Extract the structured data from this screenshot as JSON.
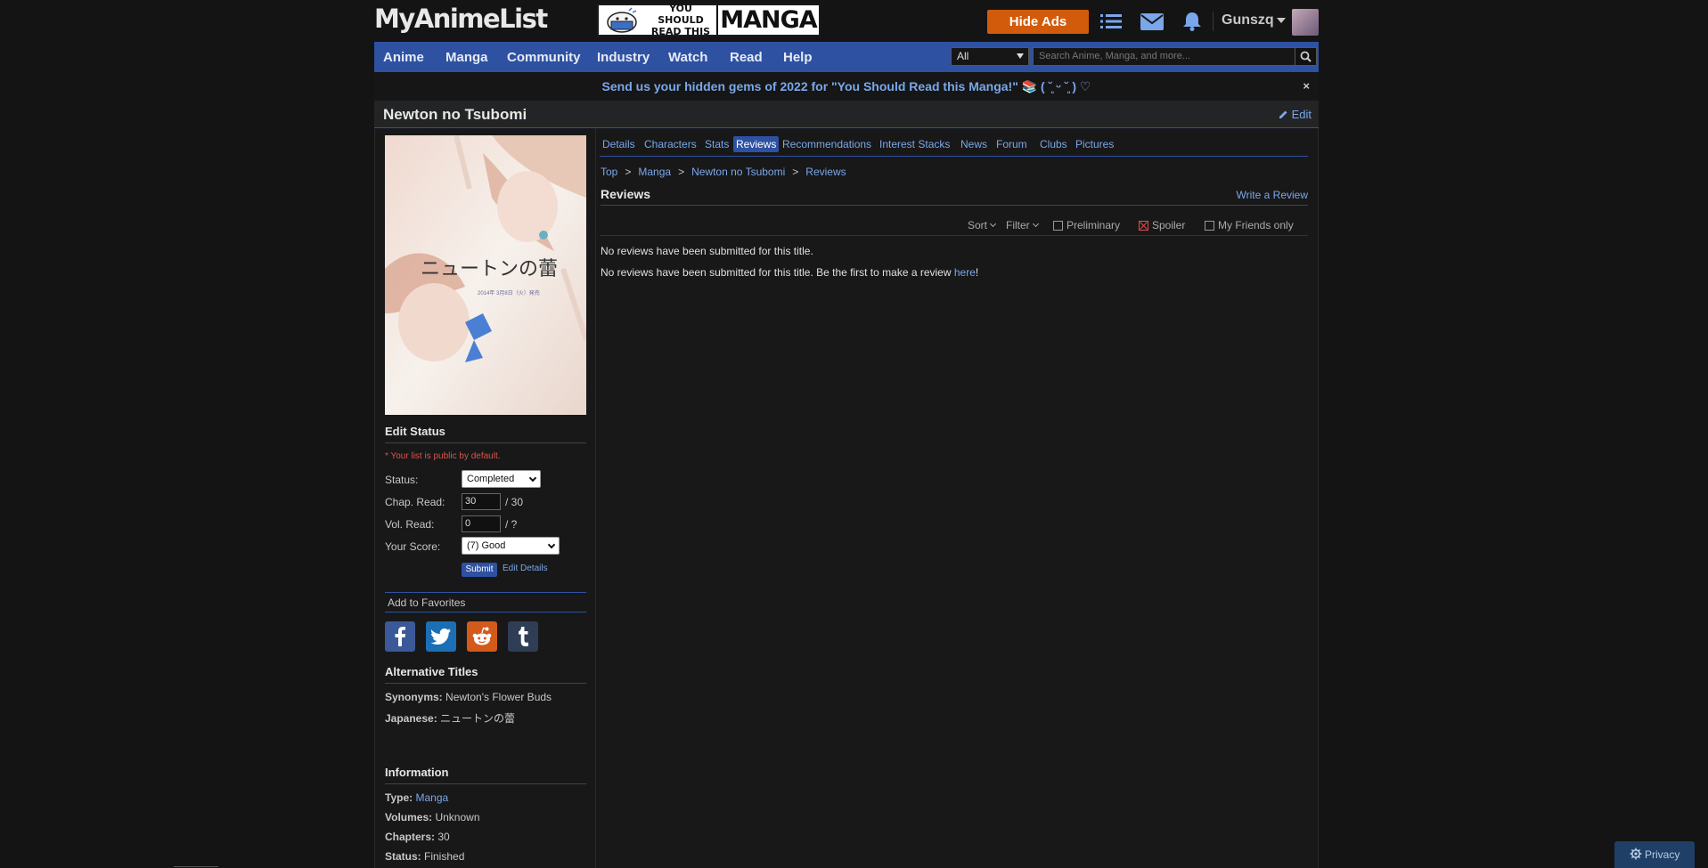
{
  "header": {
    "logo": "MyAnimeList",
    "banner_small": "YOU SHOULD READ THIS",
    "banner_big": "MANGA",
    "hide_ads": "Hide Ads",
    "username": "Gunszq"
  },
  "nav": {
    "items": [
      "Anime",
      "Manga",
      "Community",
      "Industry",
      "Watch",
      "Read",
      "Help"
    ],
    "search_scope": "All",
    "search_placeholder": "Search Anime, Manga, and more..."
  },
  "announcement": {
    "text": "Send us your hidden gems of 2022 for \"You Should Read this Manga!\" 📚 ( ˘͈ ᵕ ˘͈ ) ♡",
    "close": "×"
  },
  "title": {
    "text": "Newton no Tsubomi",
    "edit": "Edit"
  },
  "cover": {
    "text_main": "ニュートンの蕾",
    "text_sub": "2014年 3月8日（火）発売"
  },
  "edit_status": {
    "heading": "Edit Status",
    "note": "* Your list is public by default.",
    "status_label": "Status:",
    "status_value": "Completed",
    "chap_label": "Chap. Read:",
    "chap_value": "30",
    "chap_total": "/ 30",
    "vol_label": "Vol. Read:",
    "vol_value": "0",
    "vol_total": "/ ?",
    "score_label": "Your Score:",
    "score_value": "(7) Good",
    "submit": "Submit",
    "edit_details": "Edit Details"
  },
  "add_favorites": "Add to Favorites",
  "alt_titles": {
    "heading": "Alternative Titles",
    "synonyms_label": "Synonyms:",
    "synonyms_value": "Newton's Flower Buds",
    "japanese_label": "Japanese:",
    "japanese_value": "ニュートンの蕾"
  },
  "information": {
    "heading": "Information",
    "type_label": "Type:",
    "type_value": "Manga",
    "volumes_label": "Volumes:",
    "volumes_value": "Unknown",
    "chapters_label": "Chapters:",
    "chapters_value": "30",
    "status_label": "Status:",
    "status_value": "Finished"
  },
  "tabs": [
    "Details",
    "Characters",
    "Stats",
    "Reviews",
    "Recommendations",
    "Interest Stacks",
    "News",
    "Forum",
    "Clubs",
    "Pictures"
  ],
  "active_tab": "Reviews",
  "breadcrumb": [
    "Top",
    "Manga",
    "Newton no Tsubomi",
    "Reviews"
  ],
  "reviews": {
    "heading": "Reviews",
    "write": "Write a Review",
    "sort": "Sort",
    "filter": "Filter",
    "preliminary": "Preliminary",
    "spoiler": "Spoiler",
    "friends": "My Friends only",
    "empty1": "No reviews have been submitted for this title.",
    "empty2_prefix": "No reviews have been submitted for this title. Be the first to make a review ",
    "empty2_link": "here",
    "empty2_suffix": "!"
  },
  "privacy": "Privacy",
  "colors": {
    "nav_blue": "#2e51a2",
    "hide_ads_orange": "#d25b0b",
    "link_blue": "#7aa7ea",
    "background": "#181818"
  }
}
